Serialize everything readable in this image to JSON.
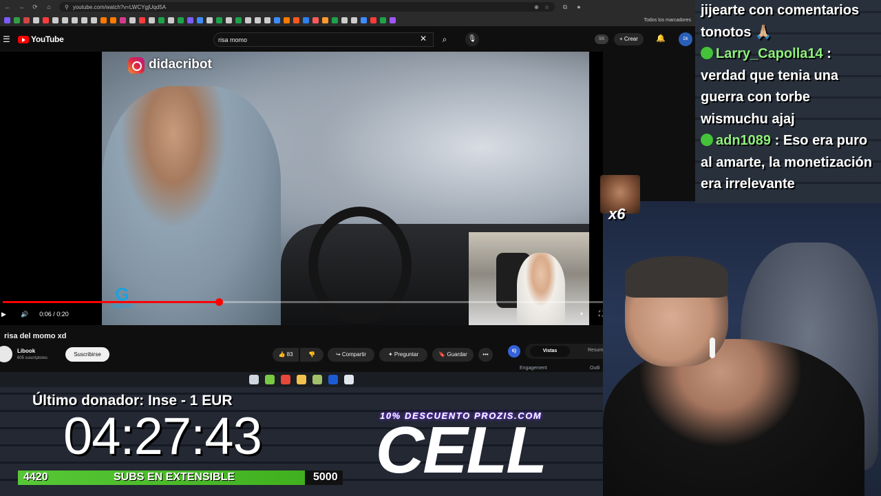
{
  "browser": {
    "url": "youtube.com/watch?v=LWCYgjUqd5A",
    "bookmarks_folder": "Todos los marcadores",
    "bookmark_colors": [
      "#7b5cff",
      "#2ea043",
      "#d24545",
      "#cccccc",
      "#ff3b3b",
      "#cccccc",
      "#cccccc",
      "#cccccc",
      "#cccccc",
      "#cccccc",
      "#ff7a00",
      "#ff7a00",
      "#d53b8b",
      "#cccccc",
      "#ff3b3b",
      "#cccccc",
      "#1ca34a",
      "#cccccc",
      "#1ca34a",
      "#7b5cff",
      "#3d8cff",
      "#cccccc",
      "#1ca34a",
      "#cccccc",
      "#1ca34a",
      "#cccccc",
      "#cccccc",
      "#cccccc",
      "#3d8cff",
      "#ff7a00",
      "#ff5722",
      "#2f80ed",
      "#ff5b5b",
      "#ff9a2e",
      "#1ca34a",
      "#cccccc",
      "#cccccc",
      "#3d8cff",
      "#ff3b3b",
      "#1ca34a",
      "#a055ff"
    ]
  },
  "youtube": {
    "logo": "YouTube",
    "search_value": "risa momo",
    "create_label": "Crear",
    "ss_badge": "SS",
    "avatar_text": "Dli"
  },
  "video": {
    "watermark_handle": "didacribot",
    "sponsor_logo": "logitech",
    "time": "0:06 / 0:20",
    "progress_fraction": 0.36,
    "title": "risa del momo xd"
  },
  "channel": {
    "name": "Libook",
    "subscribers": "605 suscriptores",
    "subscribe_label": "Suscribirse"
  },
  "actions": {
    "likes": "83",
    "share": "Compartir",
    "ask": "Preguntar",
    "save": "Guardar"
  },
  "side_panel": {
    "badge": "IQ",
    "tab_active": "Vistas",
    "tab_other": "Resum",
    "engagement": "Engagement",
    "outline": "Outli"
  },
  "taskbar": {
    "icon_colors": [
      "#cfd6df",
      "#7ac943",
      "#e8473b",
      "#f2c14e",
      "#a0c06a",
      "#1c5bd3",
      "#e1e6ee"
    ]
  },
  "overlay": {
    "donor": "Último donador: Inse - 1 EUR",
    "timer": "04:27:43",
    "subs_current": "4420",
    "subs_label": "SUBS EN EXTENSIBLE",
    "subs_goal": "5000",
    "subs_fraction": 0.884,
    "promo": "10% DESCUENTO PROZIS.COM",
    "brand": "CELL"
  },
  "chat": [
    {
      "user": "",
      "message": "jijearte con comentarios tonotos 🙏🏼"
    },
    {
      "user": "Larry_Capolla14",
      "message": "verdad que tenia una guerra con torbe wismuchu ajaj"
    },
    {
      "user": "adn1089",
      "message": "Eso era puro al amarte, la monetización era irrelevante"
    }
  ],
  "emote_count": "x6"
}
